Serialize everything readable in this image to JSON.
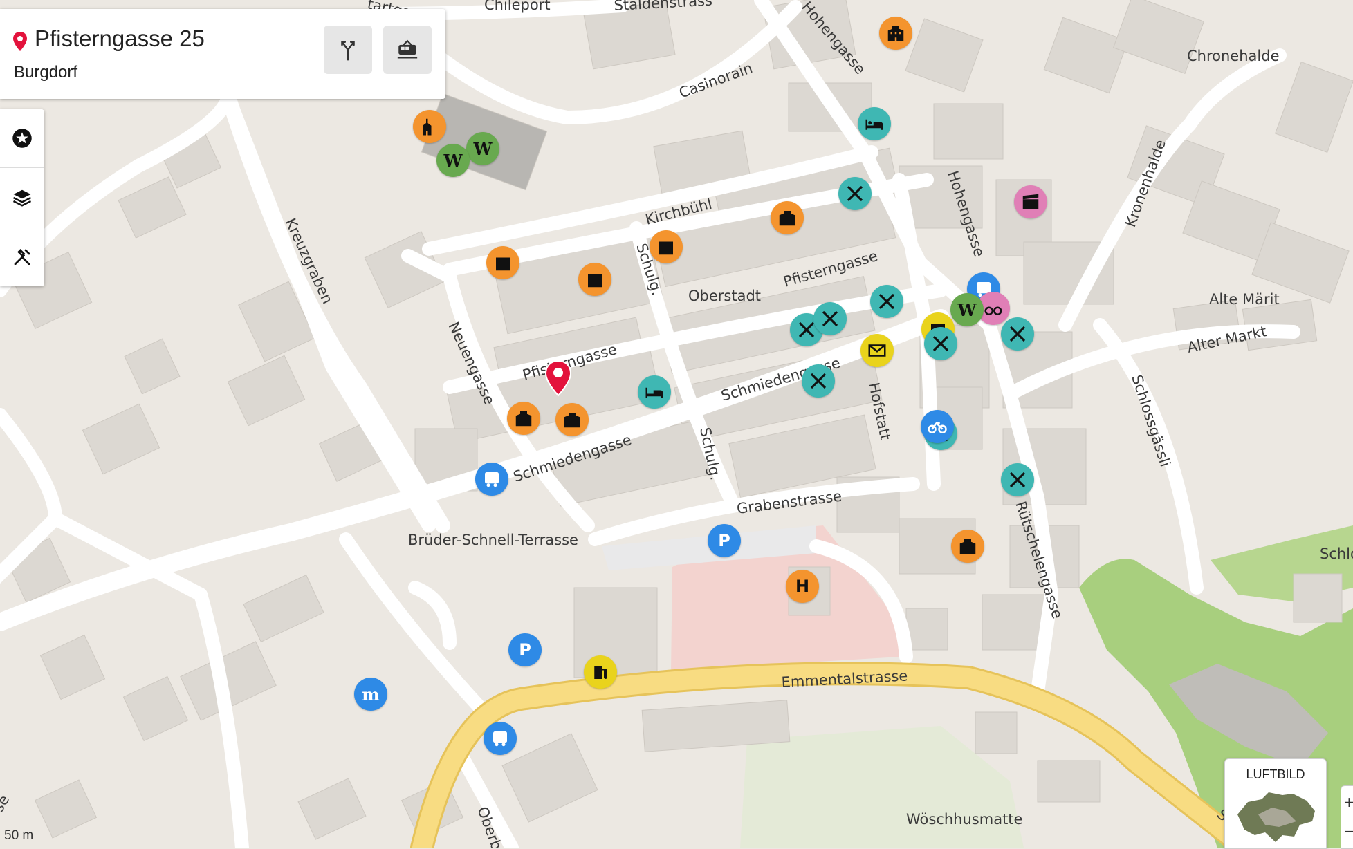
{
  "place": {
    "title": "Pfisterngasse 25",
    "subtitle": "Burgdorf"
  },
  "card_buttons": [
    {
      "name": "directions-icon"
    },
    {
      "name": "public-transport-icon"
    }
  ],
  "tools": [
    {
      "name": "favorites-star-icon"
    },
    {
      "name": "layers-icon"
    },
    {
      "name": "tools-icon"
    }
  ],
  "scale_label": "50 m",
  "aerial_toggle": {
    "label": "LUFTBILD"
  },
  "zoom": {
    "plus": "+",
    "minus": "−"
  },
  "street_labels": {
    "staldenstrasse": "Staldenstrass",
    "chileport": "Chileport",
    "tartgas": "tartgas",
    "hohengasse_top": "Hohengasse",
    "chronehalde": "Chronehalde",
    "casinorain": "Casinorain",
    "kronenhalde": "Kronenhalde",
    "kreuzgraben": "Kreuzgraben",
    "kirchbuehl": "Kirchbühl",
    "hohengasse": "Hohengasse",
    "schulg_upper": "Schulg.",
    "oberstadt": "Oberstadt",
    "pfisterngasse_upper": "Pfisterngasse",
    "alte_maerit": "Alte Märit",
    "alter_markt": "Alter Markt",
    "neuengasse": "Neuengasse",
    "pfisterngasse_lower": "Pfisterngasse",
    "schmiedengasse_upper": "Schmiedengasse",
    "hofstatt": "Hofstatt",
    "schlossgaessli": "Schlossgässli",
    "schmiedengasse_lower": "Schmiedengasse",
    "schulg_lower": "Schulg.",
    "grabenstrasse": "Grabenstrasse",
    "ruetschelengasse": "Rütschelengasse",
    "bruder_schnell": "Brüder-Schnell-Terrasse",
    "schlo_edge": "Schlo",
    "emmentalstrasse": "Emmentalstrasse",
    "woeschhusmatte": "Wöschhusmatte",
    "oberbu": "Oberbu",
    "se_left": "se",
    "s_right": "S"
  },
  "poi_glyphs": {
    "hospital": "H",
    "parking": "P",
    "migros": "m"
  },
  "colors": {
    "hotel_orange": "#f4942e",
    "restaurant_teal": "#3fb7b3",
    "wikipedia_green": "#68a94f",
    "transport_blue": "#2e8ae6",
    "cinema_pink": "#e07fb6",
    "post_yellow": "#e9d31c",
    "pin_red": "#e3123c"
  }
}
